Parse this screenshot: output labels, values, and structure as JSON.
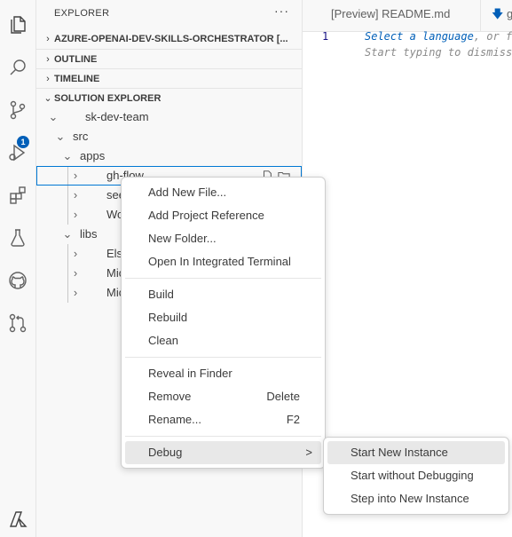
{
  "activity_bar": {
    "items": [
      {
        "icon": "files-icon"
      },
      {
        "icon": "search-icon"
      },
      {
        "icon": "source-control-icon",
        "badge": "1"
      },
      {
        "icon": "run-debug-icon"
      },
      {
        "icon": "extensions-icon"
      },
      {
        "icon": "testing-icon"
      },
      {
        "icon": "github-icon"
      },
      {
        "icon": "pull-request-icon"
      },
      {
        "icon": "azure-icon"
      }
    ]
  },
  "sidebar": {
    "title": "EXPLORER",
    "more": "···",
    "sections": {
      "workspace": "AZURE-OPENAI-DEV-SKILLS-ORCHESTRATOR [...",
      "outline": "OUTLINE",
      "timeline": "TIMELINE",
      "solution": "SOLUTION EXPLORER"
    },
    "tree": {
      "root": "sk-dev-team",
      "src": "src",
      "apps": "apps",
      "app_items": [
        "gh-flow",
        "seed",
        "Wo"
      ],
      "libs": "libs",
      "lib_items": [
        "Els",
        "Mic",
        "Mic"
      ]
    }
  },
  "editor": {
    "tabs": [
      "[Preview] README.md",
      "g"
    ],
    "line_number": "1",
    "hint_line1_a": "Select a language",
    "hint_line1_b": ", or f",
    "hint_line2": "Start typing to dismiss"
  },
  "context_menu": {
    "group1": [
      "Add New File...",
      "Add Project Reference",
      "New Folder...",
      "Open In Integrated Terminal"
    ],
    "group2": [
      "Build",
      "Rebuild",
      "Clean"
    ],
    "group3": [
      {
        "label": "Reveal in Finder",
        "key": ""
      },
      {
        "label": "Remove",
        "key": "Delete"
      },
      {
        "label": "Rename...",
        "key": "F2"
      }
    ],
    "debug": "Debug",
    "debug_arrow": ">"
  },
  "submenu": {
    "items": [
      "Start New Instance",
      "Start without Debugging",
      "Step into New Instance"
    ]
  },
  "colors": {
    "accent": "#005fb8",
    "selection_border": "#0078d4"
  }
}
